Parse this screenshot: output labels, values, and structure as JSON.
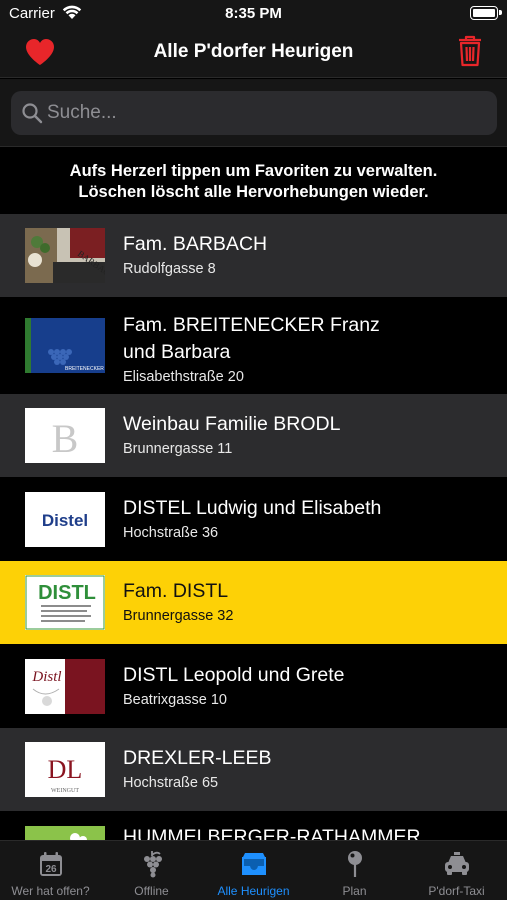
{
  "status": {
    "carrier": "Carrier",
    "time": "8:35 PM"
  },
  "nav": {
    "title": "Alle P'dorfer Heurigen",
    "left_icon": "heart-icon",
    "right_icon": "trash-icon",
    "accent": "#e8262a"
  },
  "search": {
    "placeholder": "Suche...",
    "value": ""
  },
  "hint": {
    "line1": "Aufs Herzerl tippen um Favoriten zu verwalten.",
    "line2": "Löschen löscht alle Hervorhebungen wieder."
  },
  "list": {
    "items": [
      {
        "title": "Fam. BARBACH",
        "title2": "",
        "address": "Rudolfgasse 8",
        "logo_text": "BARBACH",
        "highlighted": false
      },
      {
        "title": "Fam. BREITENECKER Franz",
        "title2": "und Barbara",
        "address": "Elisabethstraße 20",
        "logo_text": "BREITENECKER",
        "highlighted": false
      },
      {
        "title": "Weinbau Familie BRODL",
        "title2": "",
        "address": "Brunnergasse 11",
        "logo_text": "B",
        "highlighted": false
      },
      {
        "title": "DISTEL Ludwig und Elisabeth",
        "title2": "",
        "address": "Hochstraße 36",
        "logo_text": "Distel",
        "highlighted": false
      },
      {
        "title": "Fam. DISTL",
        "title2": "",
        "address": "Brunnergasse 32",
        "logo_text": "DISTL",
        "highlighted": true
      },
      {
        "title": "DISTL Leopold und Grete",
        "title2": "",
        "address": "Beatrixgasse 10",
        "logo_text": "Distl",
        "highlighted": false
      },
      {
        "title": "DREXLER-LEEB",
        "title2": "",
        "address": "Hochstraße 65",
        "logo_text": "DL",
        "logo_sub": "WEINGUT",
        "highlighted": false
      },
      {
        "title": "HUMMELBERGER-RATHAMMER",
        "title2": "",
        "address": "",
        "logo_text": "",
        "highlighted": false
      }
    ]
  },
  "tabs": [
    {
      "label": "Wer hat offen?",
      "icon": "calendar-icon",
      "calendar_day": "26",
      "active": false
    },
    {
      "label": "Offline",
      "icon": "grapes-icon",
      "active": false
    },
    {
      "label": "Alle Heurigen",
      "icon": "tray-icon",
      "active": true
    },
    {
      "label": "Plan",
      "icon": "map-pin-icon",
      "active": false
    },
    {
      "label": "P'dorf-Taxi",
      "icon": "taxi-icon",
      "active": false
    }
  ],
  "colors": {
    "highlight": "#fdd106",
    "active_tab": "#1e90ff",
    "row_gray": "#2c2c2e"
  }
}
